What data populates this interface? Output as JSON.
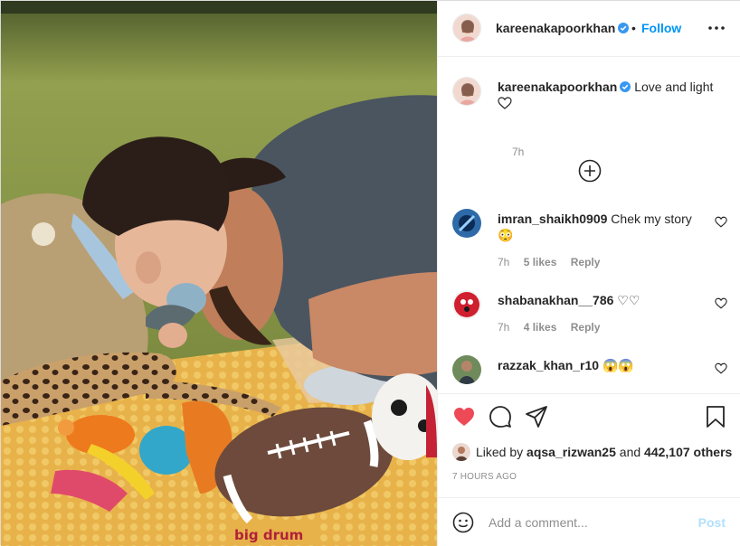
{
  "post": {
    "username": "kareenakapoorkhan",
    "separator": "•",
    "follow_label": "Follow",
    "more_icon": "more-options-icon",
    "verified_color": "#3897f0",
    "caption": {
      "text": "Love and light",
      "time": "7h"
    }
  },
  "comments": [
    {
      "username": "imran_shaikh0909",
      "text": "Chek my story",
      "emoji": "😳",
      "time": "7h",
      "likes": "5 likes",
      "reply": "Reply"
    },
    {
      "username": "shabanakhan__786",
      "text": "♡♡",
      "time": "7h",
      "likes": "4 likes",
      "reply": "Reply"
    },
    {
      "username": "razzak_khan_r10",
      "text": "😱😱"
    }
  ],
  "actions": {
    "liked_prefix": "Liked by",
    "liked_user": "aqsa_rizwan25",
    "and_text": "and",
    "others": "442,107 others",
    "timestamp": "7 HOURS AGO"
  },
  "add_comment": {
    "placeholder": "Add a comment...",
    "post_label": "Post"
  },
  "colors": {
    "accent": "#0095f6",
    "like_red": "#ed4956",
    "muted": "#8e8e8e"
  },
  "photo": {
    "mat_caption": "big drum"
  }
}
